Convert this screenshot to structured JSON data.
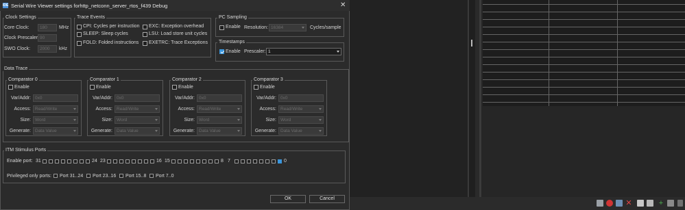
{
  "window": {
    "title": "Serial Wire Viewer settings forhttp_netconn_server_rtos_f439 Debug",
    "app_icon": "IDE",
    "close": "✕"
  },
  "clock_settings": {
    "title": "Clock Settings",
    "core_clock_label": "Core Clock:",
    "core_clock_value": "180",
    "core_clock_unit": "MHz",
    "prescaler_label": "Clock Prescaler:",
    "prescaler_value": "90",
    "swo_label": "SWO Clock:",
    "swo_value": "2000",
    "swo_unit": "kHz"
  },
  "trace_events": {
    "title": "Trace Events",
    "items": [
      "CPI: Cycles per instruction",
      "SLEEP: Sleep cycles",
      "FOLD: Folded instructions",
      "EXC: Exception overhead",
      "LSU: Load store unit cycles",
      "EXETRC: Trace Exceptions"
    ]
  },
  "pc_sampling": {
    "title": "PC Sampling",
    "enable_label": "Enable",
    "resolution_label": "Resolution:",
    "resolution_value": "16384",
    "unit": "Cycles/sample"
  },
  "timestamps": {
    "title": "Timestamps",
    "enable_label": "Enable",
    "enable_checked": true,
    "prescaler_label": "Prescaler:",
    "prescaler_value": "1"
  },
  "data_trace": {
    "title": "Data Trace",
    "comparators": [
      {
        "title": "Comparator 0",
        "enable": "Enable",
        "var_label": "Var/Addr:",
        "var_value": "0x0",
        "access_label": "Access:",
        "access_value": "Read/Write",
        "size_label": "Size:",
        "size_value": "Word",
        "generate_label": "Generate:",
        "generate_value": "Data Value"
      },
      {
        "title": "Comparator 1",
        "enable": "Enable",
        "var_label": "Var/Addr:",
        "var_value": "0x0",
        "access_label": "Access:",
        "access_value": "Read/Write",
        "size_label": "Size:",
        "size_value": "Word",
        "generate_label": "Generate:",
        "generate_value": "Data Value"
      },
      {
        "title": "Comparator 2",
        "enable": "Enable",
        "var_label": "Var/Addr:",
        "var_value": "0x0",
        "access_label": "Access:",
        "access_value": "Read/Write",
        "size_label": "Size:",
        "size_value": "Word",
        "generate_label": "Generate:",
        "generate_value": "Data Value"
      },
      {
        "title": "Comparator 3",
        "enable": "Enable",
        "var_label": "Var/Addr:",
        "var_value": "0x0",
        "access_label": "Access:",
        "access_value": "Read/Write",
        "size_label": "Size:",
        "size_value": "Word",
        "generate_label": "Generate:",
        "generate_value": "Data Value"
      }
    ]
  },
  "itm": {
    "title": "ITM Stimulus Ports",
    "enable_label": "Enable port:",
    "group_labels": [
      [
        "31",
        "24"
      ],
      [
        "23",
        "16"
      ],
      [
        "15",
        "8"
      ],
      [
        "7",
        "0"
      ]
    ],
    "checked_port": 0,
    "privileged_label": "Privileged only ports:",
    "privileged": [
      "Port 31..24",
      "Port 23..16",
      "Port 15..8",
      "Port 7..0"
    ]
  },
  "buttons": {
    "ok": "OK",
    "cancel": "Cancel"
  },
  "colors": {
    "accent": "#3a96dd",
    "dialog_bg": "#2b2b2b",
    "border": "#5a5a5a"
  },
  "toolbar_icons": [
    "tools-icon",
    "record-icon",
    "save-icon",
    "delete-icon",
    "clipboard-icon",
    "clipboard-icon",
    "settings-icon",
    "add-icon",
    "export-icon"
  ]
}
